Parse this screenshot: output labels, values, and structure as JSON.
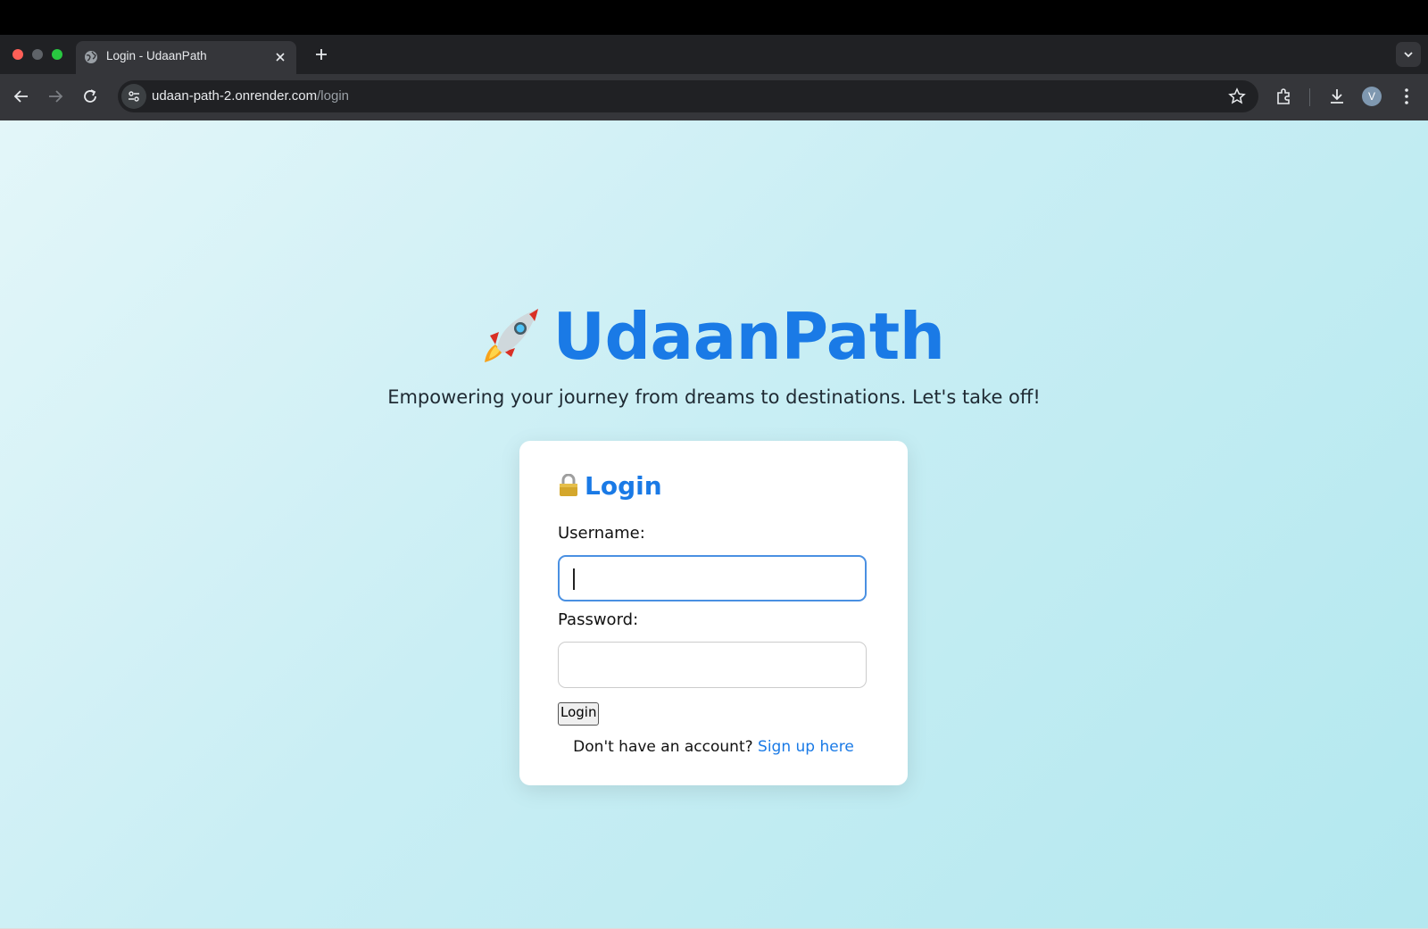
{
  "browser": {
    "tab_title": "Login - UdaanPath",
    "url_host": "udaan-path-2.onrender.com",
    "url_path": "/login",
    "avatar_letter": "V"
  },
  "page": {
    "brand": "UdaanPath",
    "tagline": "Empowering your journey from dreams to destinations. Let's take off!"
  },
  "login_card": {
    "title": "Login",
    "username_label": "Username:",
    "username_value": "",
    "password_label": "Password:",
    "password_value": "",
    "submit_label": "Login",
    "signup_prompt": "Don't have an account?",
    "signup_link": "Sign up here"
  },
  "icons": {
    "brand_icon": "rocket-icon",
    "title_icon": "lock-icon"
  },
  "colors": {
    "accent": "#1a7ae6",
    "focus_border": "#4a90e2"
  }
}
